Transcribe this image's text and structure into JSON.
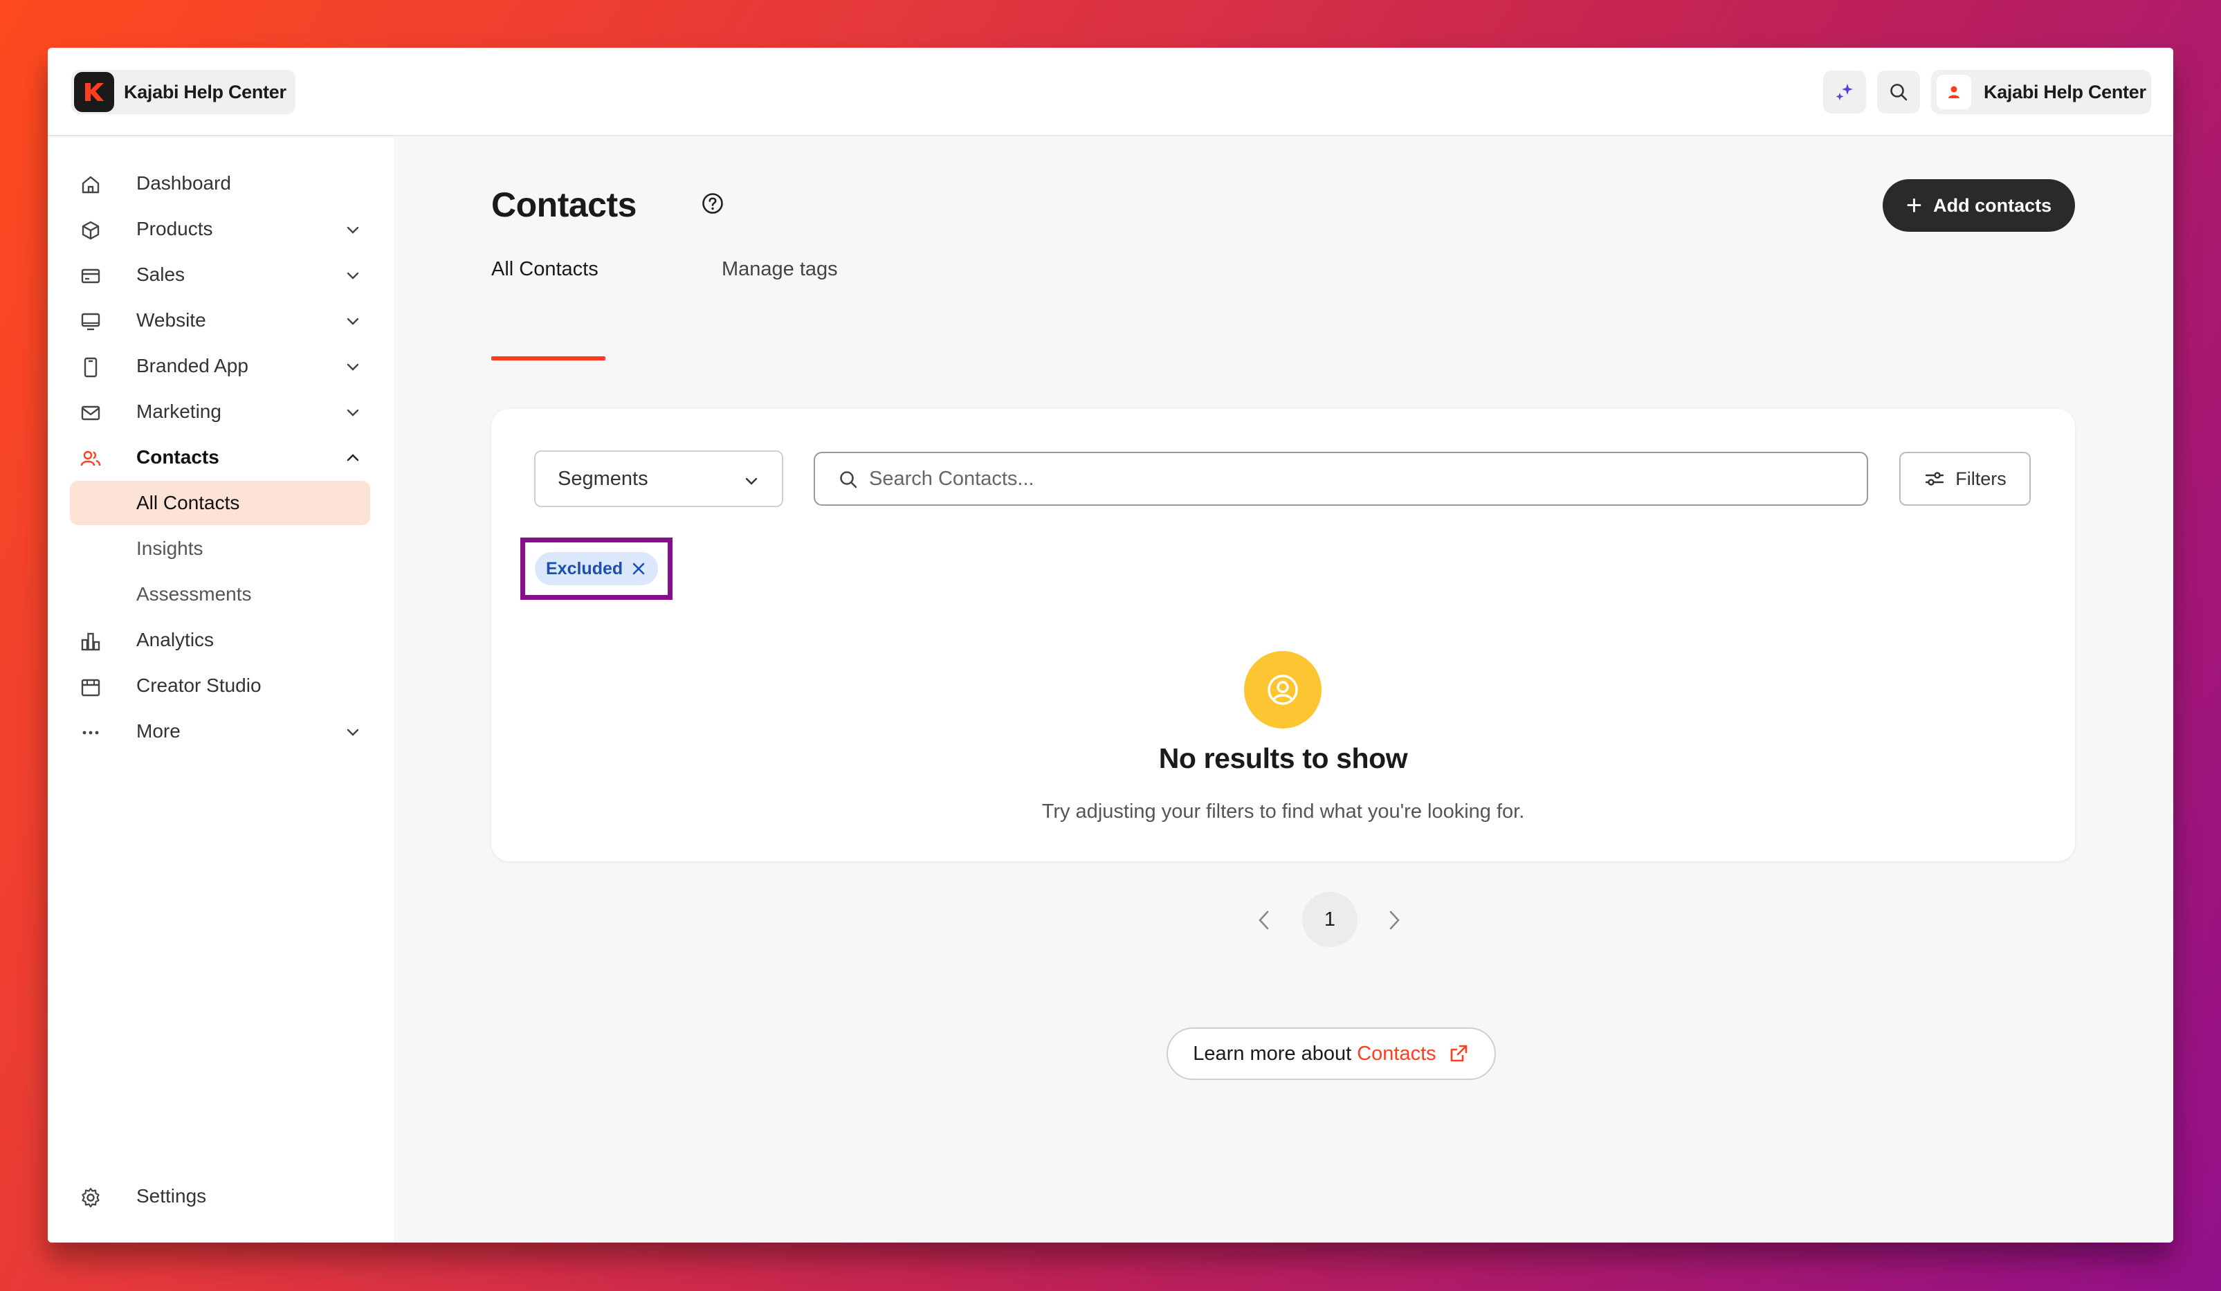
{
  "topbar": {
    "brand_name": "Kajabi Help Center",
    "profile_name": "Kajabi Help Center"
  },
  "sidebar": {
    "items": [
      {
        "label": "Dashboard",
        "icon": "home-icon"
      },
      {
        "label": "Products",
        "icon": "cube-icon"
      },
      {
        "label": "Sales",
        "icon": "credit-card-icon"
      },
      {
        "label": "Website",
        "icon": "monitor-icon"
      },
      {
        "label": "Branded App",
        "icon": "mobile-icon"
      },
      {
        "label": "Marketing",
        "icon": "mail-icon"
      },
      {
        "label": "Contacts",
        "icon": "users-icon"
      },
      {
        "label": "All Contacts"
      },
      {
        "label": "Insights"
      },
      {
        "label": "Assessments"
      },
      {
        "label": "Analytics",
        "icon": "bar-chart-icon"
      },
      {
        "label": "Creator Studio",
        "icon": "calendar-icon"
      },
      {
        "label": "More",
        "icon": "ellipsis-icon"
      }
    ],
    "settings_label": "Settings"
  },
  "main": {
    "title": "Contacts",
    "add_button_label": "Add contacts",
    "tabs": [
      {
        "label": "All Contacts"
      },
      {
        "label": "Manage tags"
      }
    ],
    "segments_label": "Segments",
    "search_placeholder": "Search Contacts...",
    "filters_label": "Filters",
    "active_filter_chip": "Excluded",
    "empty_title": "No results to show",
    "empty_subtitle": "Try adjusting your filters to find what you're looking for.",
    "current_page": "1",
    "learn_more_prefix": "Learn more about",
    "learn_more_link": "Contacts"
  },
  "colors": {
    "accent": "#ff3d1f",
    "highlight_frame": "#85108a",
    "chip_bg": "#dbe8fb",
    "empty_icon_bg": "#fdc531"
  }
}
